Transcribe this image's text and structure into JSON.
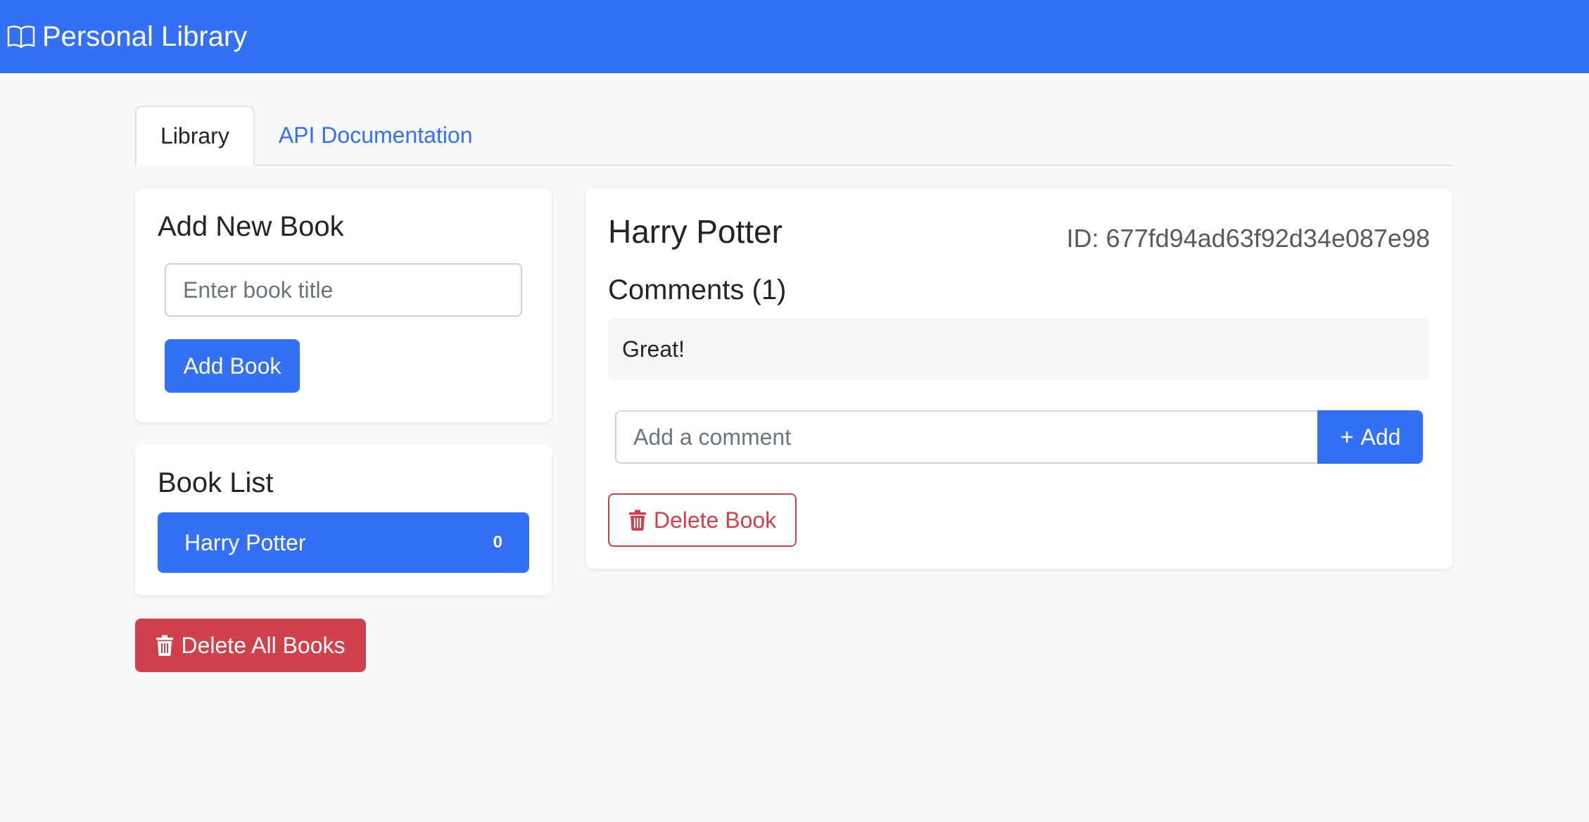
{
  "navbar": {
    "brand_title": "Personal Library",
    "brand_icon": "book-open-icon",
    "brand_color": "#3470f5"
  },
  "tabs": [
    {
      "label": "Library",
      "active": true
    },
    {
      "label": "API Documentation",
      "active": false
    }
  ],
  "add_book": {
    "title": "Add New Book",
    "input_placeholder": "Enter book title",
    "input_value": "",
    "button_label": "Add Book"
  },
  "book_list": {
    "title": "Book List",
    "items": [
      {
        "title": "Harry Potter",
        "comment_count": "0",
        "selected": true
      }
    ]
  },
  "delete_all": {
    "label": "Delete All Books",
    "icon": "trash-icon"
  },
  "detail": {
    "book_title": "Harry Potter",
    "id_text": "ID: 677fd94ad63f92d34e087e98",
    "comments_heading": "Comments (1)",
    "comments": [
      "Great!"
    ],
    "comment_placeholder": "Add a comment",
    "comment_value": "",
    "add_button_label": "Add",
    "add_button_icon": "plus-icon",
    "delete_button_label": "Delete Book",
    "delete_button_icon": "trash-icon"
  },
  "colors": {
    "primary": "#3470f5",
    "danger": "#d0414b",
    "background": "#f7f8fa"
  }
}
